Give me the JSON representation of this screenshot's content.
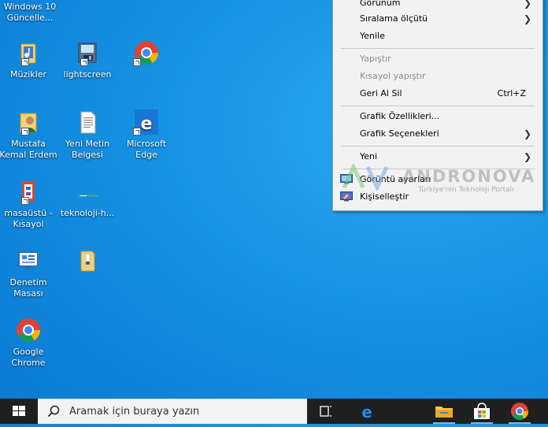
{
  "desktop_icons": [
    {
      "label": "Windows 10\nGüncelle..."
    },
    {
      "label": "Müzikler"
    },
    {
      "label": "lightscreen"
    },
    {
      "label": ""
    },
    {
      "label": "Mustafa\nKemal Erdem"
    },
    {
      "label": "Yeni Metin\nBelgesi"
    },
    {
      "label": "Microsoft\nEdge"
    },
    {
      "label": "masaüstü -\nKısayol"
    },
    {
      "label": "teknoloji-h..."
    },
    {
      "label": "Denetim\nMasası"
    },
    {
      "label": ""
    },
    {
      "label": "Google\nChrome"
    }
  ],
  "context_menu": {
    "items": [
      {
        "label": "Görünüm",
        "submenu": true
      },
      {
        "label": "Sıralama ölçütü",
        "submenu": true
      },
      {
        "label": "Yenile"
      },
      {
        "label": "Yapıştır",
        "disabled": true
      },
      {
        "label": "Kısayol yapıştır",
        "disabled": true
      },
      {
        "label": "Geri Al Sil",
        "shortcut": "Ctrl+Z"
      },
      {
        "label": "Grafik Özellikleri..."
      },
      {
        "label": "Grafik Seçenekleri",
        "submenu": true
      },
      {
        "label": "Yeni",
        "submenu": true
      },
      {
        "label": "Görüntü ayarları",
        "icon": "display-settings-icon"
      },
      {
        "label": "Kişiselleştir",
        "icon": "personalize-icon"
      }
    ]
  },
  "watermark": {
    "brand": "ANDRONOVA",
    "tagline": "Türkiye'nin Teknoloji Portalı"
  },
  "taskbar": {
    "search_placeholder": "Aramak için buraya yazın",
    "pinned": [
      "task-view-icon",
      "edge-icon",
      "file-explorer-icon",
      "store-icon",
      "chrome-icon"
    ]
  },
  "colors": {
    "desktop_blue": "#1592e3",
    "taskbar": "#1f1f1f",
    "menu_bg": "#f2f2f2"
  }
}
